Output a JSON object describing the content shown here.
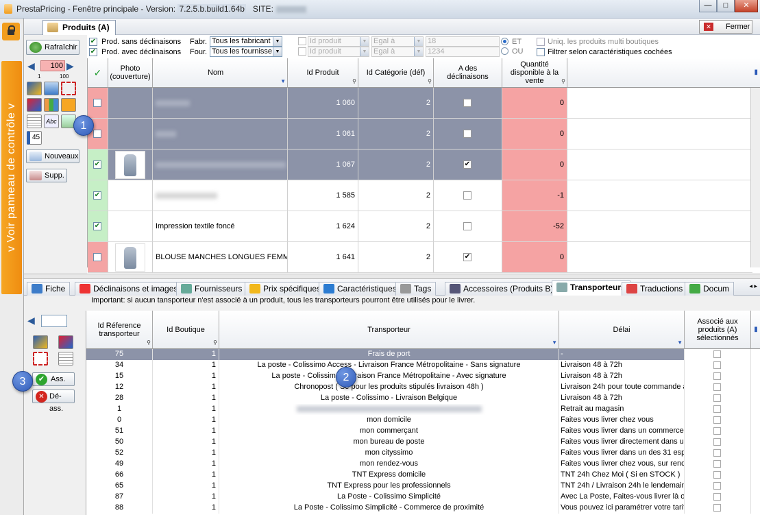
{
  "window": {
    "title": "PrestaPricing - Fenêtre principale  -  Version:",
    "version": "7.2.5.b.build1.64b",
    "site_label": "SITE:",
    "min": "—",
    "max": "□",
    "close": "✕"
  },
  "sidebar": {
    "toggle_label": "v  Voir panneau de contrôle  v"
  },
  "top": {
    "tab_label": "Produits (A)",
    "close_label": "Fermer",
    "refresh_label": "Rafraîchir",
    "count_value": "100",
    "scale_min": "1",
    "scale_max": "100",
    "label45": "45",
    "new_label": "Nouveaux",
    "del_label": "Supp.",
    "filters": {
      "prod_sans": "Prod. sans déclinaisons",
      "prod_avec": "Prod. avec déclinaisons",
      "fabr_label": "Fabr.",
      "fabr_value": "Tous les fabricant",
      "four_label": "Four.",
      "four_value": "Tous les fournisse",
      "field1": "Id produit",
      "op1": "Egal à",
      "val1": "18",
      "field2": "Id produit",
      "op2": "Egal à",
      "val2": "1234",
      "et": "ET",
      "ou": "OU",
      "uniq": "Uniq. les produits multi boutiques",
      "filtrer": "Filtrer selon caractéristiques cochées"
    },
    "columns": {
      "check": "✓",
      "photo": "Photo (couverture)",
      "nom": "Nom",
      "id": "Id Produit",
      "cat": "Id Catégorie (déf)",
      "decl": "A des déclinaisons",
      "qty": "Quantité disponible à la vente"
    },
    "rows": [
      {
        "checked": false,
        "name": "",
        "id": "1 060",
        "cat": "2",
        "decl": false,
        "qty": "0"
      },
      {
        "checked": false,
        "name": "",
        "id": "1 061",
        "cat": "2",
        "decl": false,
        "qty": "0"
      },
      {
        "checked": true,
        "name": "",
        "id": "1 067",
        "cat": "2",
        "decl": true,
        "qty": "0"
      },
      {
        "checked": true,
        "name": "",
        "id": "1 585",
        "cat": "2",
        "decl": false,
        "qty": "-1"
      },
      {
        "checked": true,
        "name": "Impression textile foncé",
        "id": "1 624",
        "cat": "2",
        "decl": false,
        "qty": "-52"
      },
      {
        "checked": false,
        "name": "BLOUSE MANCHES LONGUES FEMME",
        "id": "1 641",
        "cat": "2",
        "decl": true,
        "qty": "0"
      }
    ]
  },
  "bottom": {
    "tabs": [
      "Fiche",
      "Déclinaisons et images",
      "Fournisseurs",
      "Prix spécifiques",
      "Caractéristiques",
      "Tags",
      "Accessoires (Produits B)",
      "Transporteurs",
      "Traductions",
      "Docum"
    ],
    "note": "Important: si aucun tansporteur n'est associé à un produit, tous les transporteurs pourront être utilisés pour le livrer.",
    "ass_label": "Ass.",
    "deass_label": "Dé-ass.",
    "columns": {
      "idref": "Id Réference transporteur",
      "idb": "Id Boutique",
      "trans": "Transporteur",
      "delai": "Délai",
      "assoc": "Associé aux produits (A) sélectionnés"
    },
    "rows": [
      {
        "idref": "75",
        "idb": "1",
        "trans": "Frais de port",
        "delai": "-"
      },
      {
        "idref": "34",
        "idb": "1",
        "trans": "La poste - Colissimo  Access - Livraison France Métropolitaine - Sans signature",
        "delai": "Livraison 48 à 72h"
      },
      {
        "idref": "15",
        "idb": "1",
        "trans": "La poste - Colissimo  E      ivraison France Métropolitaine -  Avec signature",
        "delai": "Livraison 48 à 72h"
      },
      {
        "idref": "12",
        "idb": "1",
        "trans": "Chronopost ( Se       pour les produits stipulés livraison 48h )",
        "delai": "Livraison 24h pour toute commande av"
      },
      {
        "idref": "28",
        "idb": "1",
        "trans": "La poste - Colissimo - Livraison Belgique",
        "delai": "Livraison 48 à 72h"
      },
      {
        "idref": "1",
        "idb": "1",
        "trans": "",
        "delai": "Retrait au magasin"
      },
      {
        "idref": "0",
        "idb": "1",
        "trans": "mon domicile",
        "delai": "Faites vous livrer chez vous"
      },
      {
        "idref": "51",
        "idb": "1",
        "trans": "mon commerçant",
        "delai": "Faites vous livrer dans un commerce p"
      },
      {
        "idref": "50",
        "idb": "1",
        "trans": "mon bureau de poste",
        "delai": "Faites vous livrer directement dans un"
      },
      {
        "idref": "52",
        "idb": "1",
        "trans": "mon cityssimo",
        "delai": "Faites vous livrer dans un des 31 espa"
      },
      {
        "idref": "49",
        "idb": "1",
        "trans": "mon rendez-vous",
        "delai": "Faites vous livrer chez vous, sur rende"
      },
      {
        "idref": "66",
        "idb": "1",
        "trans": "TNT Express domicile",
        "delai": "TNT 24h Chez Moi ( Si en STOCK )"
      },
      {
        "idref": "65",
        "idb": "1",
        "trans": "TNT Express pour les professionnels",
        "delai": "TNT 24h / Livraison 24h le lendemain"
      },
      {
        "idref": "87",
        "idb": "1",
        "trans": "La Poste - Colissimo Simplicité",
        "delai": "Avec La Poste, Faites-vous livrer là ou"
      },
      {
        "idref": "88",
        "idb": "1",
        "trans": "La Poste - Colissimo Simplicité - Commerce de proximité",
        "delai": "Vous pouvez ici paramétrer votre tarif p"
      }
    ]
  },
  "badges": [
    "1",
    "2",
    "3"
  ],
  "colors": {
    "accent": "#f29d1d",
    "selected_row": "#8c93a8",
    "qty_bg": "#f5a3a3",
    "check_col": "#f4a4a4"
  }
}
